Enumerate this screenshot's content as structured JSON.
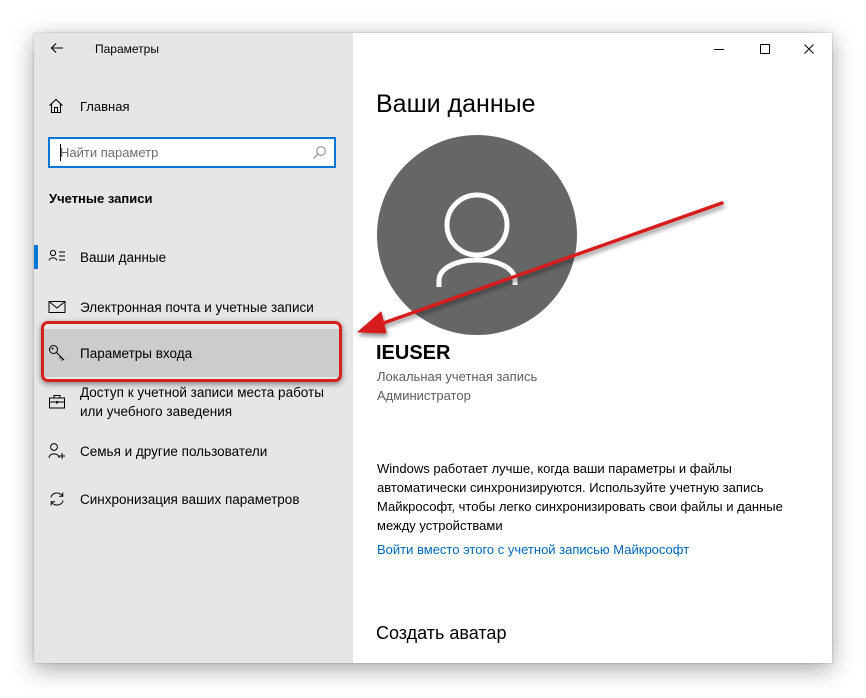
{
  "window": {
    "title": "Параметры"
  },
  "sidebar": {
    "home_label": "Главная",
    "search": {
      "placeholder": "Найти параметр",
      "value": ""
    },
    "section_title": "Учетные записи",
    "items": [
      {
        "label": "Ваши данные",
        "icon": "user-card-icon"
      },
      {
        "label": "Электронная почта и учетные записи",
        "icon": "mail-icon"
      },
      {
        "label": "Параметры входа",
        "icon": "key-icon"
      },
      {
        "label": "Доступ к учетной записи места работы или учебного заведения",
        "icon": "briefcase-icon"
      },
      {
        "label": "Семья и другие пользователи",
        "icon": "user-add-icon"
      },
      {
        "label": "Синхронизация ваших параметров",
        "icon": "sync-icon"
      }
    ]
  },
  "main": {
    "title": "Ваши данные",
    "user_name": "IEUSER",
    "account_type": "Локальная учетная запись",
    "account_role": "Администратор",
    "info_text": "Windows работает лучше, когда ваши параметры и файлы автоматически синхронизируются. Используйте учетную запись Майкрософт, чтобы легко синхронизировать свои файлы и данные между устройствами",
    "ms_link": "Войти вместо этого с учетной записью Майкрософт",
    "avatar_section_title": "Создать аватар"
  },
  "colors": {
    "accent": "#0078d7",
    "link": "#0067b8",
    "sidebar_bg": "#e6e6e6",
    "selected_bg": "#cccccc",
    "avatar_bg": "#666666",
    "annotation_red": "#d61f1f"
  }
}
